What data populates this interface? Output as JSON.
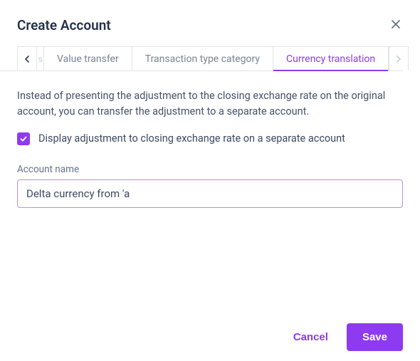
{
  "dialog": {
    "title": "Create Account"
  },
  "tabs": {
    "ghost_prev": "s",
    "items": [
      "Value transfer",
      "Transaction type category",
      "Currency translation"
    ],
    "active_index": 2
  },
  "content": {
    "description": "Instead of presenting the adjustment to the closing exchange rate on the original account, you can transfer the adjustment to a separate account.",
    "checkbox_label": "Display adjustment to closing exchange rate on a separate account",
    "checkbox_checked": true,
    "account_name_label": "Account name",
    "account_name_value": "Delta currency from 'a"
  },
  "footer": {
    "cancel_label": "Cancel",
    "save_label": "Save"
  }
}
